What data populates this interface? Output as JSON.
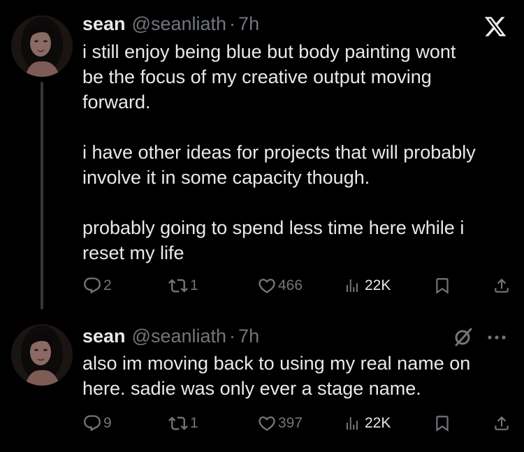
{
  "tweets": [
    {
      "author": {
        "display_name": "sean",
        "handle": "@seanliath",
        "separator": "·",
        "time": "7h"
      },
      "text": "i still enjoy being blue but body painting wont\nbe the focus of my creative output moving\nforward.\n\ni have other ideas for projects that will probably\ninvolve it in some capacity though.\n\nprobably going to spend less time here while i\nreset my life",
      "stats": {
        "replies": "2",
        "reposts": "1",
        "likes": "466",
        "views": "22K"
      },
      "corner_icon": "x-logo-icon"
    },
    {
      "author": {
        "display_name": "sean",
        "handle": "@seanliath",
        "separator": "·",
        "time": "7h"
      },
      "text": "also im moving back to using my real name on\nhere. sadie was only ever a stage name.",
      "stats": {
        "replies": "9",
        "reposts": "1",
        "likes": "397",
        "views": "22K"
      },
      "corner_icons": [
        "grok-icon",
        "more-icon"
      ]
    }
  ],
  "theme": {
    "background": "#000000",
    "text_primary": "#e7e9ea",
    "text_secondary": "#71767b",
    "thread_line": "#333639"
  },
  "icons": {
    "reply": "reply-icon",
    "repost": "repost-icon",
    "like": "like-icon",
    "views": "views-icon",
    "bookmark": "bookmark-icon",
    "share": "share-icon"
  }
}
